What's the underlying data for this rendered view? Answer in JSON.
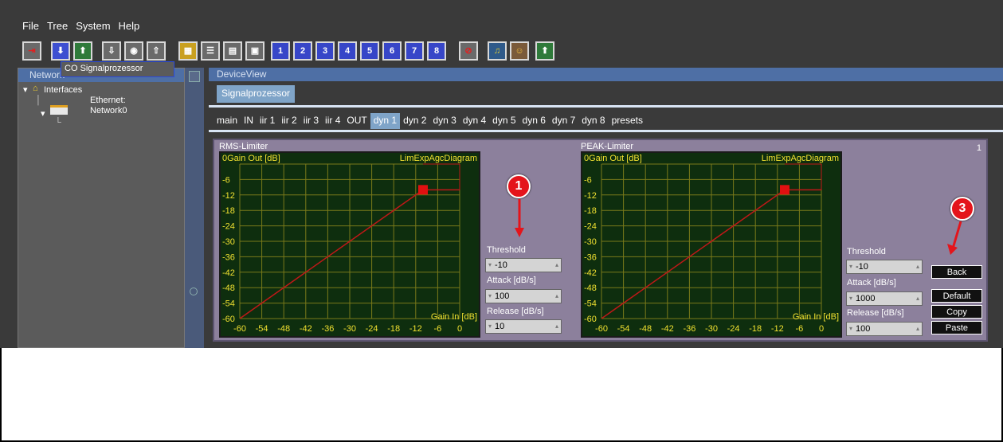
{
  "menu": [
    "File",
    "Tree",
    "System",
    "Help"
  ],
  "toolbar": {
    "numbered": [
      "1",
      "2",
      "3",
      "4",
      "5",
      "6",
      "7",
      "8"
    ]
  },
  "network": {
    "title": "Network",
    "tree": {
      "interfaces": "Interfaces",
      "ethernet_line1": "Ethernet:",
      "ethernet_line2": "Network0",
      "device_prefix": "CO",
      "device_name": "Signalprozessor"
    }
  },
  "device_view": {
    "title": "DeviceView",
    "device_tab": "Signalprozessor",
    "subtabs": [
      "main",
      "IN",
      "iir 1",
      "iir 2",
      "iir 3",
      "iir 4",
      "OUT",
      "dyn 1",
      "dyn 2",
      "dyn 3",
      "dyn 4",
      "dyn 5",
      "dyn 6",
      "dyn 7",
      "dyn 8",
      "presets"
    ],
    "active_subtab": "dyn 1"
  },
  "panel": {
    "index": "1",
    "buttons": {
      "back": "Back",
      "default": "Default",
      "copy": "Copy",
      "paste": "Paste"
    }
  },
  "limiters": [
    {
      "title": "RMS-Limiter",
      "diagram_label": "LimExpAgcDiagram",
      "threshold_label": "Threshold",
      "threshold": "-10",
      "attack_label": "Attack [dB/s]",
      "attack": "100",
      "release_label": "Release [dB/s]",
      "release": "10"
    },
    {
      "title": "PEAK-Limiter",
      "diagram_label": "LimExpAgcDiagram",
      "threshold_label": "Threshold",
      "threshold": "-10",
      "attack_label": "Attack [dB/s]",
      "attack": "1000",
      "release_label": "Release [dB/s]",
      "release": "100"
    }
  ],
  "chart_data": [
    {
      "type": "line",
      "ylabel": "Gain Out [dB]",
      "xlabel": "Gain In [dB]",
      "x_ticks": [
        "-60",
        "-54",
        "-48",
        "-42",
        "-36",
        "-30",
        "-24",
        "-18",
        "-12",
        "-6",
        "0"
      ],
      "y_ticks": [
        "0",
        "-6",
        "-12",
        "-18",
        "-24",
        "-30",
        "-36",
        "-42",
        "-48",
        "-54",
        "-60"
      ],
      "xlim": [
        -60,
        0
      ],
      "ylim": [
        -60,
        0
      ],
      "series": [
        {
          "x": [
            -60,
            -10,
            0
          ],
          "y": [
            -60,
            -10,
            -10
          ]
        }
      ],
      "marker": {
        "x": -10,
        "y": -10
      },
      "grid": true,
      "line_color": "#c01818",
      "grid_color": "#7a7a1a"
    },
    {
      "type": "line",
      "ylabel": "Gain Out [dB]",
      "xlabel": "Gain In [dB]",
      "x_ticks": [
        "-60",
        "-54",
        "-48",
        "-42",
        "-36",
        "-30",
        "-24",
        "-18",
        "-12",
        "-6",
        "0"
      ],
      "y_ticks": [
        "0",
        "-6",
        "-12",
        "-18",
        "-24",
        "-30",
        "-36",
        "-42",
        "-48",
        "-54",
        "-60"
      ],
      "xlim": [
        -60,
        0
      ],
      "ylim": [
        -60,
        0
      ],
      "series": [
        {
          "x": [
            -60,
            -10,
            0
          ],
          "y": [
            -60,
            -10,
            -10
          ]
        }
      ],
      "marker": {
        "x": -10,
        "y": -10
      },
      "grid": true,
      "line_color": "#c01818",
      "grid_color": "#7a7a1a"
    }
  ],
  "callouts": [
    "1",
    "3"
  ]
}
